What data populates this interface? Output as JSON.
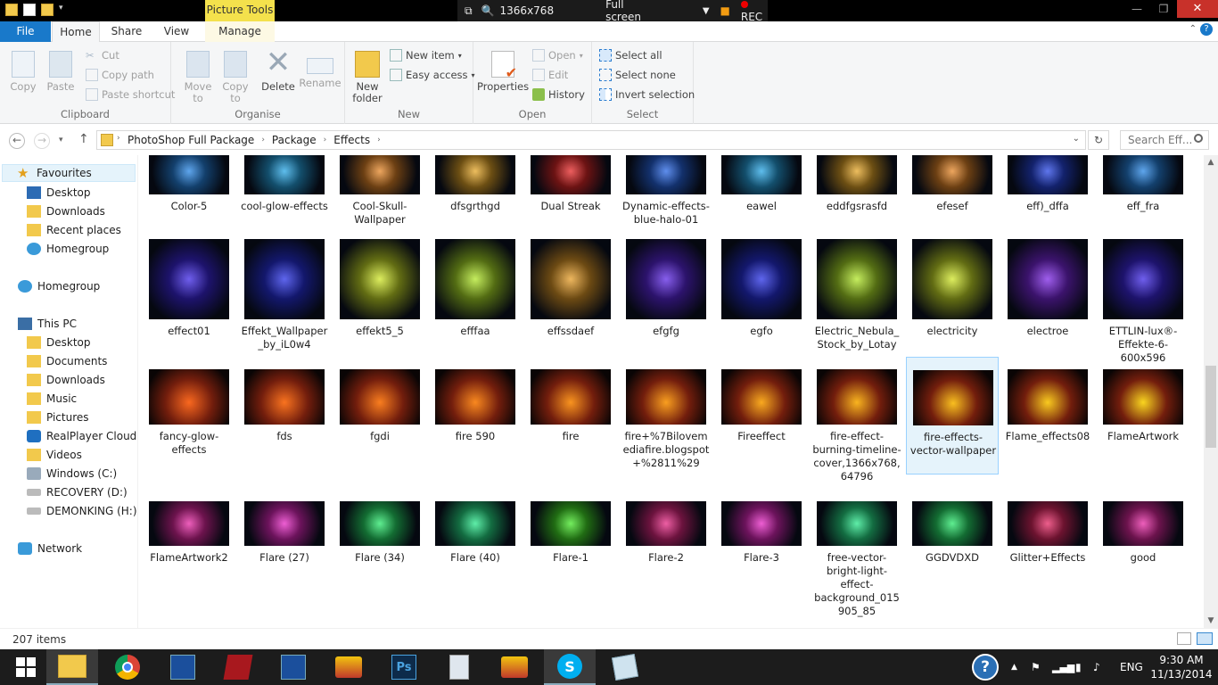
{
  "titlebar": {
    "contextual_tab": "Picture Tools",
    "recorder": {
      "resolution": "1366x768",
      "mode": "Full screen",
      "rec": "REC"
    }
  },
  "ribbon_tabs": {
    "file": "File",
    "home": "Home",
    "share": "Share",
    "view": "View",
    "manage": "Manage"
  },
  "ribbon": {
    "clipboard": {
      "label": "Clipboard",
      "copy": "Copy",
      "paste": "Paste",
      "cut": "Cut",
      "copy_path": "Copy path",
      "paste_shortcut": "Paste shortcut"
    },
    "organise": {
      "label": "Organise",
      "move_to": "Move to",
      "copy_to": "Copy to",
      "delete": "Delete",
      "rename": "Rename"
    },
    "new": {
      "label": "New",
      "new_folder": "New folder",
      "new_item": "New item",
      "easy_access": "Easy access"
    },
    "open": {
      "label": "Open",
      "properties": "Properties",
      "open": "Open",
      "edit": "Edit",
      "history": "History"
    },
    "select": {
      "label": "Select",
      "select_all": "Select all",
      "select_none": "Select none",
      "invert": "Invert selection"
    }
  },
  "address": {
    "crumbs": [
      "PhotoShop Full Package",
      "Package",
      "Effects"
    ],
    "search_placeholder": "Search Eff..."
  },
  "nav": {
    "favourites": "Favourites",
    "fav_items": [
      "Desktop",
      "Downloads",
      "Recent places",
      "Homegroup"
    ],
    "homegroup": "Homegroup",
    "this_pc": "This PC",
    "pc_items": [
      "Desktop",
      "Documents",
      "Downloads",
      "Music",
      "Pictures",
      "RealPlayer Cloud",
      "Videos",
      "Windows (C:)",
      "RECOVERY (D:)",
      "DEMONKING (H:)"
    ],
    "network": "Network"
  },
  "files": [
    [
      "Color-5",
      "cool-glow-effects",
      "Cool-Skull-Wallpaper",
      "dfsgrthgd",
      "Dual Streak",
      "Dynamic-effects-blue-halo-01",
      "eawel",
      "eddfgsrasfd",
      "efesef",
      "eff)_dffa",
      "eff_fra"
    ],
    [
      "effect01",
      "Effekt_Wallpaper_by_iL0w4",
      "effekt5_5",
      "efffaa",
      "effssdaef",
      "efgfg",
      "egfo",
      "Electric_Nebula_Stock_by_Lotay",
      "electricity",
      "electroe",
      "ETTLIN-lux®-Effekte-6-600x596"
    ],
    [
      "fancy-glow-effects",
      "fds",
      "fgdi",
      "fire 590",
      "fire",
      "fire+%7Bilovemediafire.blogspot+%2811%29",
      "Fireeffect",
      "fire-effect-burning-timeline-cover,1366x768,64796",
      "fire-effects-vector-wallpaper",
      "Flame_effects08",
      "FlameArtwork"
    ],
    [
      "FlameArtwork2",
      "Flare (27)",
      "Flare (34)",
      "Flare (40)",
      "Flare-1",
      "Flare-2",
      "Flare-3",
      "free-vector-bright-light-effect-background_015905_85",
      "GGDVDXD",
      "Glitter+Effects",
      "good"
    ]
  ],
  "status": {
    "count": "207 items"
  },
  "taskbar": {
    "lang": "ENG",
    "time": "9:30 AM",
    "date": "11/13/2014"
  }
}
